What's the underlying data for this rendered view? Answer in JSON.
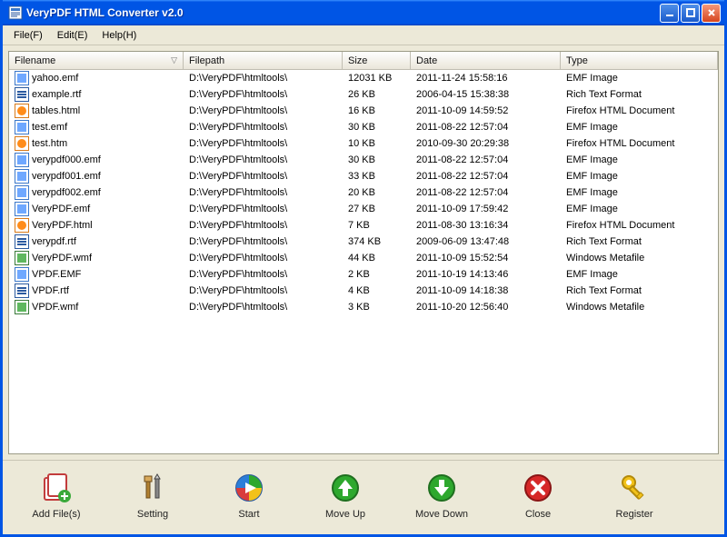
{
  "window": {
    "title": "VeryPDF HTML Converter v2.0"
  },
  "menu": {
    "file": "File(F)",
    "edit": "Edit(E)",
    "help": "Help(H)"
  },
  "columns": {
    "filename": "Filename",
    "filepath": "Filepath",
    "size": "Size",
    "date": "Date",
    "type": "Type"
  },
  "rows": [
    {
      "icon": "emf",
      "filename": "yahoo.emf",
      "filepath": "D:\\VeryPDF\\htmltools\\",
      "size": "12031 KB",
      "date": "2011-11-24 15:58:16",
      "type": "EMF Image"
    },
    {
      "icon": "rtf",
      "filename": "example.rtf",
      "filepath": "D:\\VeryPDF\\htmltools\\",
      "size": "26 KB",
      "date": "2006-04-15 15:38:38",
      "type": "Rich Text Format"
    },
    {
      "icon": "html",
      "filename": "tables.html",
      "filepath": "D:\\VeryPDF\\htmltools\\",
      "size": "16 KB",
      "date": "2011-10-09 14:59:52",
      "type": "Firefox HTML Document"
    },
    {
      "icon": "emf",
      "filename": "test.emf",
      "filepath": "D:\\VeryPDF\\htmltools\\",
      "size": "30 KB",
      "date": "2011-08-22 12:57:04",
      "type": "EMF Image"
    },
    {
      "icon": "html",
      "filename": "test.htm",
      "filepath": "D:\\VeryPDF\\htmltools\\",
      "size": "10 KB",
      "date": "2010-09-30 20:29:38",
      "type": "Firefox HTML Document"
    },
    {
      "icon": "emf",
      "filename": "verypdf000.emf",
      "filepath": "D:\\VeryPDF\\htmltools\\",
      "size": "30 KB",
      "date": "2011-08-22 12:57:04",
      "type": "EMF Image"
    },
    {
      "icon": "emf",
      "filename": "verypdf001.emf",
      "filepath": "D:\\VeryPDF\\htmltools\\",
      "size": "33 KB",
      "date": "2011-08-22 12:57:04",
      "type": "EMF Image"
    },
    {
      "icon": "emf",
      "filename": "verypdf002.emf",
      "filepath": "D:\\VeryPDF\\htmltools\\",
      "size": "20 KB",
      "date": "2011-08-22 12:57:04",
      "type": "EMF Image"
    },
    {
      "icon": "emf",
      "filename": "VeryPDF.emf",
      "filepath": "D:\\VeryPDF\\htmltools\\",
      "size": "27 KB",
      "date": "2011-10-09 17:59:42",
      "type": "EMF Image"
    },
    {
      "icon": "html",
      "filename": "VeryPDF.html",
      "filepath": "D:\\VeryPDF\\htmltools\\",
      "size": "7 KB",
      "date": "2011-08-30 13:16:34",
      "type": "Firefox HTML Document"
    },
    {
      "icon": "rtf",
      "filename": "verypdf.rtf",
      "filepath": "D:\\VeryPDF\\htmltools\\",
      "size": "374 KB",
      "date": "2009-06-09 13:47:48",
      "type": "Rich Text Format"
    },
    {
      "icon": "wmf",
      "filename": "VeryPDF.wmf",
      "filepath": "D:\\VeryPDF\\htmltools\\",
      "size": "44 KB",
      "date": "2011-10-09 15:52:54",
      "type": "Windows Metafile"
    },
    {
      "icon": "emf",
      "filename": "VPDF.EMF",
      "filepath": "D:\\VeryPDF\\htmltools\\",
      "size": "2 KB",
      "date": "2011-10-19 14:13:46",
      "type": "EMF Image"
    },
    {
      "icon": "rtf",
      "filename": "VPDF.rtf",
      "filepath": "D:\\VeryPDF\\htmltools\\",
      "size": "4 KB",
      "date": "2011-10-09 14:18:38",
      "type": "Rich Text Format"
    },
    {
      "icon": "wmf",
      "filename": "VPDF.wmf",
      "filepath": "D:\\VeryPDF\\htmltools\\",
      "size": "3 KB",
      "date": "2011-10-20 12:56:40",
      "type": "Windows Metafile"
    }
  ],
  "toolbar": {
    "addfiles": "Add File(s)",
    "setting": "Setting",
    "start": "Start",
    "moveup": "Move Up",
    "movedown": "Move Down",
    "close": "Close",
    "register": "Register"
  }
}
